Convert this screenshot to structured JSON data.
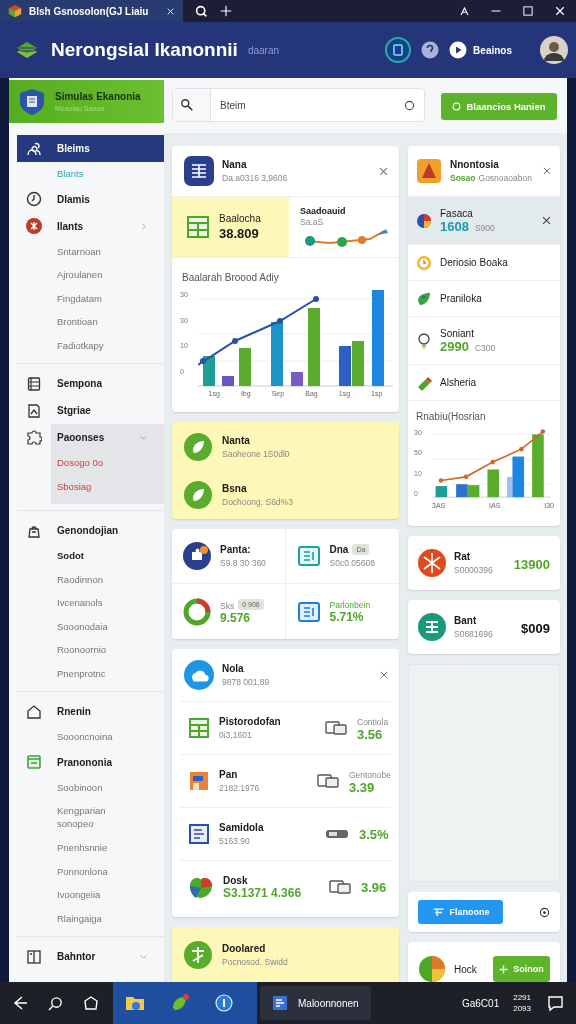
{
  "titlebar": {
    "tab_title": "Blsh Gsnosolon(GJ Liaiu"
  },
  "header": {
    "title": "Nerongsial Ikanonnii",
    "subtitle": "daaran",
    "user": "Beainos"
  },
  "sidebar": {
    "title": "Simulas Ekanonia",
    "subtitle": "Moaolau Saaoa",
    "sections": [
      {
        "items": [
          {
            "label": "Bleims",
            "selected": true,
            "highlighted": false,
            "children": [
              {
                "label": "Blants",
                "kind": "link"
              }
            ]
          },
          {
            "label": "Dlamis",
            "selected": false,
            "highlighted": false
          },
          {
            "label": "Ilants",
            "selected": false,
            "highlighted": false,
            "expanded": false,
            "children": [
              {
                "label": "Sntarnoan",
                "kind": "plain"
              },
              {
                "label": "Ajroulanen",
                "kind": "plain"
              },
              {
                "label": "Fingdatam",
                "kind": "plain"
              },
              {
                "label": "Brontioan",
                "kind": "plain"
              },
              {
                "label": "Fadiotkapy",
                "kind": "plain"
              }
            ]
          }
        ]
      },
      {
        "items": [
          {
            "label": "Sempona",
            "selected": false,
            "highlighted": false
          },
          {
            "label": "Stgriae",
            "selected": false,
            "highlighted": false
          },
          {
            "label": "Paoonses",
            "selected": false,
            "highlighted": true,
            "expanded": true,
            "children": [
              {
                "label": "Dosogo 0o",
                "kind": "alert"
              },
              {
                "label": "Sbosiag",
                "kind": "alert"
              }
            ]
          }
        ]
      },
      {
        "items": [
          {
            "label": "Genondojian",
            "selected": false,
            "highlighted": false,
            "children": [
              {
                "label": "Sodot",
                "kind": "strong"
              },
              {
                "label": "Raodinnon",
                "kind": "plain"
              },
              {
                "label": "Ivcenanols",
                "kind": "plain"
              },
              {
                "label": "Sooonodaia",
                "kind": "plain"
              },
              {
                "label": "Roonoornio",
                "kind": "plain"
              },
              {
                "label": "Pnenprotnc",
                "kind": "plain"
              }
            ]
          }
        ]
      },
      {
        "items": [
          {
            "label": "Rnenin",
            "selected": false,
            "highlighted": false,
            "children": [
              {
                "label": "Soooncnoina",
                "kind": "plain"
              }
            ]
          },
          {
            "label": "Pranononia",
            "selected": false,
            "highlighted": false,
            "children": [
              {
                "label": "Soobinoon",
                "kind": "plain"
              },
              {
                "label": "Kengparian sonopeo",
                "kind": "plain"
              },
              {
                "label": "Pnenhsnnie",
                "kind": "plain"
              },
              {
                "label": "Ponnonlona",
                "kind": "plain"
              },
              {
                "label": "Ivoongeiia",
                "kind": "plain"
              },
              {
                "label": "Rlaingaiga",
                "kind": "plain"
              }
            ]
          }
        ]
      },
      {
        "items": [
          {
            "label": "Bahntor",
            "selected": false,
            "highlighted": false,
            "expanded": true
          }
        ]
      }
    ]
  },
  "toolbar": {
    "search": {
      "placeholder": "Bteim"
    },
    "action": "Blaancios Hanien"
  },
  "summary_card": {
    "title": "Nana",
    "subtitle": "Da.a0316 3,9606",
    "highlight": {
      "label": "Baalocha",
      "value": "38.809"
    },
    "trend": {
      "label": "Saadoauid",
      "sublabel": "Sa.aS"
    },
    "chart": {
      "title": "Baalarah Broood Adiy",
      "y_labels": [
        "30",
        "30",
        "10",
        "0"
      ],
      "x_labels": [
        "1sg",
        "Ibg",
        "Sep",
        "Bag",
        "1sg",
        "1sp"
      ]
    }
  },
  "notes_card": {
    "items": [
      {
        "title": "Nanta",
        "text": "Saoheone 1S0dl0"
      },
      {
        "title": "Bsna",
        "text": "Dochoong. S6d%3"
      }
    ]
  },
  "stats_card": {
    "items": [
      {
        "kind": "info",
        "title": "Panta:",
        "value": "S9.8 30 360"
      },
      {
        "kind": "info",
        "title": "Dna",
        "badge": "Da",
        "value": "S0c0.05608"
      },
      {
        "kind": "metric",
        "title": "Sks",
        "badge": "0 906",
        "value": "9.576"
      },
      {
        "kind": "metric",
        "title": "Parlonbein",
        "value": "5.71%"
      }
    ]
  },
  "list_card": {
    "title": "Nola",
    "subtitle": "9878 001,89",
    "rows": [
      {
        "kind": "plain",
        "title": "Pistorodofan",
        "value": "0i3,1601",
        "label": "Contiola",
        "amount": "3.56"
      },
      {
        "kind": "plain",
        "title": "Pan",
        "value": "2182.1976",
        "label": "Gentonobe",
        "amount": "3.39"
      },
      {
        "kind": "plain",
        "title": "Samidola",
        "value": "5163.90",
        "amount": "3.5%"
      },
      {
        "kind": "highlight",
        "title": "Dosk",
        "value": "S3.1371 4.366",
        "amount": "3.96"
      }
    ]
  },
  "alert_card": {
    "title": "Doolared",
    "text": "Pocnosod. Swidd"
  },
  "side_card": {
    "title": "Nnontosia",
    "tag": "Sosao",
    "subtitle": "Gosnoaoabon",
    "rows": [
      {
        "kind": "value",
        "title": "Fasaca",
        "value": "1608",
        "note": "S900",
        "selected": true
      },
      {
        "kind": "plain",
        "title": "Deriosio Boaka",
        "selected": false
      },
      {
        "kind": "plain",
        "title": "Praniloka",
        "selected": false
      },
      {
        "kind": "value",
        "title": "Soniant",
        "value": "2990",
        "note": "C300",
        "selected": false
      },
      {
        "kind": "plain",
        "title": "Alsheria",
        "selected": false
      }
    ],
    "chart": {
      "title": "Rnabiu(Hosrian",
      "y_labels": [
        "30",
        "50",
        "10",
        "0"
      ],
      "x_labels": [
        "3AS",
        "IAS",
        "I30"
      ]
    }
  },
  "balances": [
    {
      "kind": "gain",
      "title": "Rat",
      "subtitle": "S0000396",
      "amount": "13900"
    },
    {
      "kind": "plain",
      "title": "Bant",
      "subtitle": "S0681696",
      "amount": "$009"
    }
  ],
  "actions": {
    "primary": "Flanoone"
  },
  "footer_card": {
    "title": "Hock",
    "button": "Soinon"
  },
  "taskbar": {
    "window_title": "Maloonnonen",
    "status": "Ga6C01",
    "time": "2291",
    "date": "2093"
  }
}
